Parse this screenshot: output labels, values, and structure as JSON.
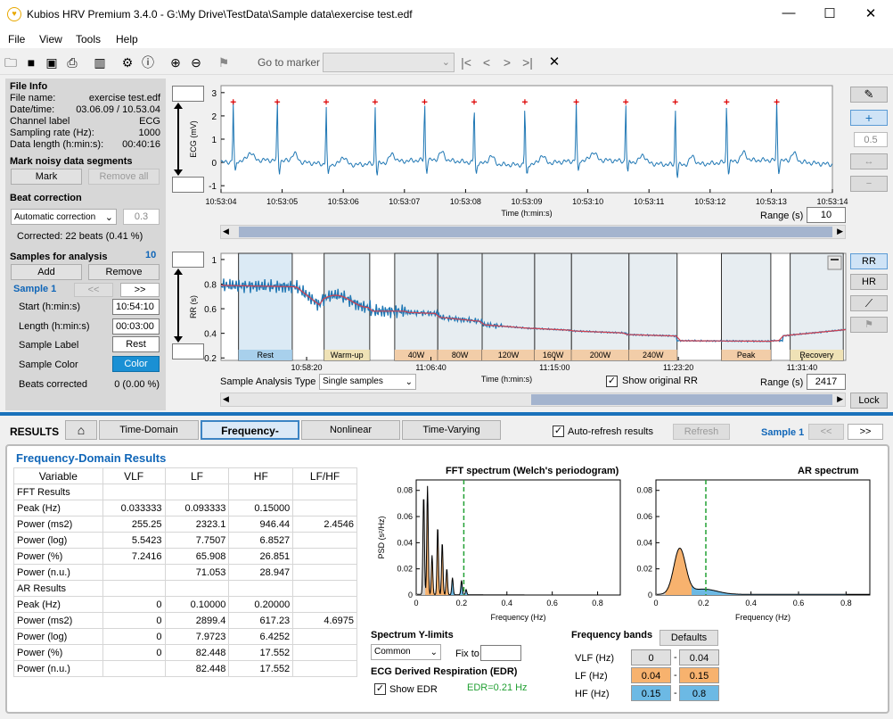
{
  "window": {
    "title": "Kubios HRV Premium 3.4.0 - G:\\My Drive\\TestData\\Sample data\\exercise test.edf",
    "minimize": "—",
    "maximize": "☐",
    "close": "✕"
  },
  "menu": [
    "File",
    "View",
    "Tools",
    "Help"
  ],
  "toolbar": {
    "goto_marker": "Go to marker"
  },
  "file_info": {
    "heading": "File Info",
    "rows": [
      [
        "File name:",
        "exercise test.edf"
      ],
      [
        "Date/time:",
        "03.06.09 / 10.53.04"
      ],
      [
        "Channel label",
        "ECG"
      ],
      [
        "Sampling rate (Hz):",
        "1000"
      ],
      [
        "Data length (h:min:s):",
        "00:40:16"
      ]
    ]
  },
  "noisy": {
    "heading": "Mark noisy data segments",
    "mark": "Mark",
    "remove_all": "Remove all"
  },
  "beat": {
    "heading": "Beat correction",
    "method": "Automatic correction",
    "threshold": "0.3",
    "corrected": "Corrected: 22 beats (0.41 %)"
  },
  "samples": {
    "heading": "Samples for analysis",
    "count": "10",
    "add": "Add",
    "remove": "Remove",
    "current": "Sample 1",
    "prev": "<<",
    "next": ">>",
    "start_label": "Start (h:min:s)",
    "start": "10:54:10",
    "length_label": "Length (h:min:s)",
    "length": "00:03:00",
    "label_label": "Sample Label",
    "label": "Rest",
    "color_label": "Sample Color",
    "color_btn": "Color",
    "beats_label": "Beats corrected",
    "beats": "0 (0.00 %)"
  },
  "ecg": {
    "ylabel": "ECG (mV)",
    "xlabel": "Time (h:min:s)",
    "yticks": [
      "3",
      "2",
      "1",
      "0",
      "-1"
    ],
    "xticks": [
      "10:53:04",
      "10:53:05",
      "10:53:06",
      "10:53:07",
      "10:53:08",
      "10:53:09",
      "10:53:10",
      "10:53:11",
      "10:53:12",
      "10:53:13",
      "10:53:14"
    ],
    "range_label": "Range (s)",
    "range": "10",
    "peaks": [
      0.2,
      0.92,
      1.72,
      2.52,
      3.33,
      4.14,
      4.97,
      5.81,
      6.62,
      7.43,
      8.27,
      9.09
    ]
  },
  "rr": {
    "ylabel": "RR (s)",
    "xlabel": "Time (h:min:s)",
    "yticks": [
      "1",
      "0.8",
      "0.6",
      "0.4",
      "0.2"
    ],
    "xticks": [
      "10:58:20",
      "11:06:40",
      "11:15:00",
      "11:23:20",
      "11:31:40"
    ],
    "segments": [
      {
        "label": "Rest",
        "color": "#a8d0ec"
      },
      {
        "label": "Warm-up",
        "color": "#efe2b6"
      },
      {
        "label": "40W",
        "color": "#f2cda8"
      },
      {
        "label": "80W",
        "color": "#f2cda8"
      },
      {
        "label": "120W",
        "color": "#f2cda8"
      },
      {
        "label": "160W",
        "color": "#f2cda8"
      },
      {
        "label": "200W",
        "color": "#f2cda8"
      },
      {
        "label": "240W",
        "color": "#f2cda8"
      },
      {
        "label": "Peak",
        "color": "#f2cda8"
      },
      {
        "label": "Recovery",
        "color": "#efe2b6"
      }
    ],
    "analysis_type_label": "Sample Analysis Type",
    "analysis_type": "Single samples",
    "show_original": "Show original RR",
    "range_label": "Range (s)",
    "range": "2417"
  },
  "side": {
    "zoom": "0.5",
    "rr": "RR",
    "hr": "HR",
    "lock": "Lock"
  },
  "results": {
    "label": "RESULTS",
    "tabs": [
      "Time-Domain",
      "Frequency-Domain",
      "Nonlinear",
      "Time-Varying"
    ],
    "auto_refresh": "Auto-refresh results",
    "refresh": "Refresh",
    "sample": "Sample 1",
    "prev": "<<",
    "next": ">>"
  },
  "freq": {
    "title": "Frequency-Domain Results",
    "headers": [
      "Variable",
      "VLF",
      "LF",
      "HF",
      "LF/HF"
    ],
    "rows": [
      [
        "FFT Results",
        "",
        "",
        "",
        ""
      ],
      [
        "Peak (Hz)",
        "0.033333",
        "0.093333",
        "0.15000",
        ""
      ],
      [
        "Power (ms2)",
        "255.25",
        "2323.1",
        "946.44",
        "2.4546"
      ],
      [
        "Power (log)",
        "5.5423",
        "7.7507",
        "6.8527",
        ""
      ],
      [
        "Power (%)",
        "7.2416",
        "65.908",
        "26.851",
        ""
      ],
      [
        "Power (n.u.)",
        "",
        "71.053",
        "28.947",
        ""
      ],
      [
        "AR Results",
        "",
        "",
        "",
        ""
      ],
      [
        "Peak (Hz)",
        "0",
        "0.10000",
        "0.20000",
        ""
      ],
      [
        "Power (ms2)",
        "0",
        "2899.4",
        "617.23",
        "4.6975"
      ],
      [
        "Power (log)",
        "0",
        "7.9723",
        "6.4252",
        ""
      ],
      [
        "Power (%)",
        "0",
        "82.448",
        "17.552",
        ""
      ],
      [
        "Power (n.u.)",
        "",
        "82.448",
        "17.552",
        ""
      ]
    ]
  },
  "fft": {
    "title": "FFT spectrum (Welch's periodogram)",
    "ylabel": "PSD (s²/Hz)",
    "xlabel": "Frequency (Hz)",
    "yticks": [
      "0.08",
      "0.06",
      "0.04",
      "0.02",
      "0"
    ],
    "xticks": [
      "0",
      "0.2",
      "0.4",
      "0.6",
      "0.8"
    ]
  },
  "ar": {
    "title": "AR spectrum",
    "xlabel": "Frequency (Hz)",
    "yticks": [
      "0.08",
      "0.06",
      "0.04",
      "0.02",
      "0"
    ],
    "xticks": [
      "0",
      "0.2",
      "0.4",
      "0.6",
      "0.8"
    ]
  },
  "ylim": {
    "heading": "Spectrum Y-limits",
    "mode": "Common",
    "fix_to": "Fix to"
  },
  "edr": {
    "heading": "ECG Derived Respiration (EDR)",
    "show": "Show EDR",
    "value": "EDR=0.21 Hz"
  },
  "bands": {
    "heading": "Frequency bands",
    "defaults": "Defaults",
    "vlf": "VLF (Hz)",
    "lf": "LF (Hz)",
    "hf": "HF (Hz)",
    "dash": "-",
    "vlf_lo": "0",
    "vlf_hi": "0.04",
    "lf_lo": "0.04",
    "lf_hi": "0.15",
    "hf_lo": "0.15",
    "hf_hi": "0.8"
  }
}
